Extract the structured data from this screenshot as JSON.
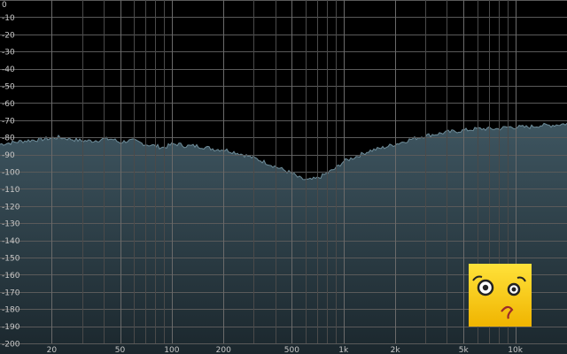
{
  "chart_data": {
    "type": "area",
    "title": "",
    "xlabel": "",
    "ylabel": "",
    "x_scale": "log",
    "xlim": [
      10,
      20000
    ],
    "ylim": [
      -200,
      0
    ],
    "grid": true,
    "y_ticks": [
      0,
      -10,
      -20,
      -30,
      -40,
      -50,
      -60,
      -70,
      -80,
      -90,
      -100,
      -110,
      -120,
      -130,
      -140,
      -150,
      -160,
      -170,
      -180,
      -190,
      -200
    ],
    "y_tick_labels": [
      "0",
      "-10",
      "-20",
      "-30",
      "-40",
      "-50",
      "-60",
      "-70",
      "-80",
      "-90",
      "-100",
      "-110",
      "-120",
      "-130",
      "-140",
      "-150",
      "-160",
      "-170",
      "-180",
      "-190",
      "-200"
    ],
    "x_tick_values": [
      20,
      50,
      100,
      200,
      500,
      1000,
      2000,
      5000,
      10000
    ],
    "x_tick_labels": [
      "20",
      "50",
      "100",
      "200",
      "500",
      "1k",
      "2k",
      "5k",
      "10k"
    ],
    "minor_x_grid": [
      30,
      40,
      60,
      70,
      80,
      90,
      300,
      400,
      600,
      700,
      800,
      900,
      3000,
      4000,
      6000,
      7000,
      8000,
      9000
    ],
    "colors": {
      "background": "#000000",
      "fill_top": "#3e5560",
      "fill_bottom": "#1b272d",
      "outline": "#6e8c99",
      "text": "#c8c8c8"
    },
    "series": [
      {
        "x": [
          10,
          14,
          18,
          22,
          26,
          30,
          35,
          40,
          45,
          50,
          55,
          60,
          70,
          80,
          90,
          100,
          110,
          120,
          140,
          160,
          180,
          200,
          240,
          280,
          320,
          360,
          400,
          450,
          500,
          560,
          620,
          700,
          800,
          900,
          1000,
          1200,
          1400,
          1700,
          2000,
          2500,
          3000,
          3500,
          4000,
          5000,
          6000,
          7000,
          8000,
          9000,
          10000,
          12000,
          14000,
          16000,
          20000
        ],
        "y": [
          -84,
          -82,
          -81,
          -80,
          -81,
          -82,
          -82,
          -81,
          -81,
          -83,
          -82,
          -82,
          -84,
          -85,
          -86,
          -84,
          -84,
          -85,
          -85,
          -86,
          -87,
          -87,
          -89,
          -91,
          -93,
          -95,
          -97,
          -99,
          -101,
          -104,
          -105,
          -104,
          -101,
          -98,
          -94,
          -91,
          -88,
          -86,
          -84,
          -81,
          -79,
          -78,
          -77,
          -76,
          -75,
          -75,
          -75,
          -74,
          -74,
          -74,
          -73,
          -73,
          -72
        ]
      }
    ]
  },
  "overlay": {
    "icon": "confused-face-icon",
    "color": "#f5c400"
  }
}
